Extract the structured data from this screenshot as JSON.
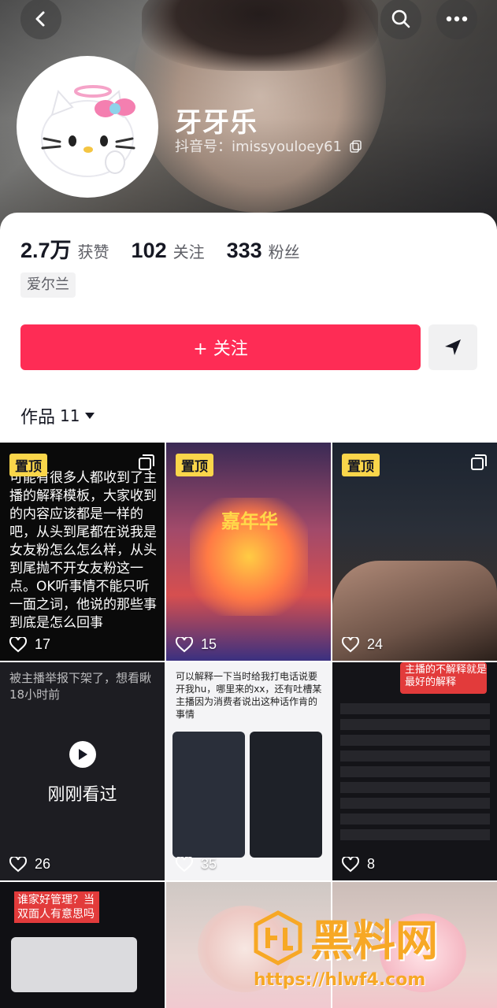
{
  "profile": {
    "name": "牙牙乐",
    "douyin_id": "抖音号：imissyouloey61"
  },
  "stats": [
    {
      "value": "2.7万",
      "label": "获赞"
    },
    {
      "value": "102",
      "label": "关注"
    },
    {
      "value": "333",
      "label": "粉丝"
    }
  ],
  "location_tag": "爱尔兰",
  "follow_button": "+ 关注",
  "works": {
    "label": "作品",
    "count": "11"
  },
  "videos": [
    {
      "pinned": "置顶",
      "likes": "17",
      "text": "可能有很多人都收到了主播的解释模板，大家收到的内容应该都是一样的吧，从头到尾都在说我是女友粉怎么怎么样，从头到尾抛不开女友粉这一点。OK听事情不能只听一面之词，他说的那些事到底是怎么回事"
    },
    {
      "pinned": "置顶",
      "likes": "15",
      "text": "嘉年华"
    },
    {
      "pinned": "置顶",
      "likes": "24",
      "text": ""
    },
    {
      "likes": "26",
      "text": "被主播举报下架了，想看瞅18小时前",
      "watched": "刚刚看过"
    },
    {
      "likes": "35",
      "text": "可以解释一下当时给我打电话说要开我hu，哪里来的xx，还有吐槽某主播因为消费者说出这种话作肯的事情"
    },
    {
      "likes": "8",
      "text": "主播的不解释就是最好的解释"
    },
    {
      "text": "谁家好管理？当双面人有意思吗"
    },
    {
      "text": ""
    },
    {
      "text": ""
    }
  ],
  "watermark": {
    "brand": "黑料网",
    "url": "https://hlwf4.com"
  },
  "colors": {
    "accent": "#fe2c55",
    "pin": "#fad64a"
  }
}
